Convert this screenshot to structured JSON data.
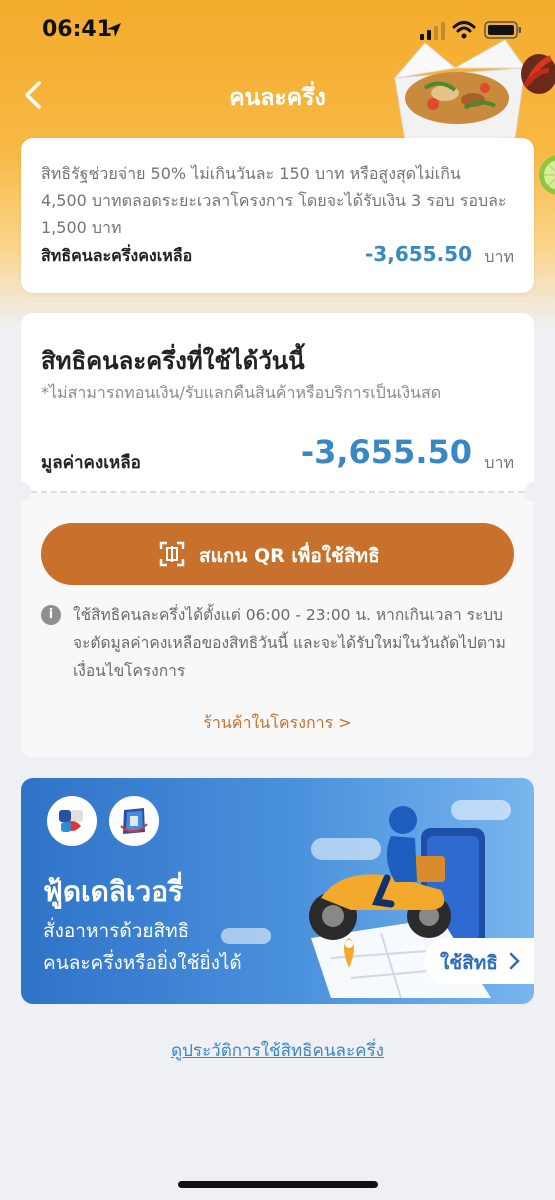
{
  "status_bar": {
    "time": "06:41"
  },
  "header": {
    "title": "คนละครึ่ง"
  },
  "summary_card": {
    "description": "สิทธิรัฐช่วยจ่าย 50% ไม่เกินวันละ 150 บาท หรือสูงสุดไม่เกิน 4,500 บาทตลอดระยะเวลาโครงการ โดยจะได้รับเงิน 3 รอบ รอบละ 1,500 บาท",
    "remaining_label": "สิทธิคนละครึ่งคงเหลือ",
    "remaining_amount": "-3,655.50",
    "unit": "บาท"
  },
  "today_card": {
    "title": "สิทธิคนละครึ่งที่ใช้ได้วันนี้",
    "note": "*ไม่สามารถทอนเงิน/รับแลกคืนสินค้าหรือบริการเป็นเงินสด",
    "balance_label": "มูลค่าคงเหลือ",
    "balance_amount": "-3,655.50",
    "unit": "บาท",
    "scan_button": "สแกน QR เพื่อใช้สิทธิ",
    "info_text": "ใช้สิทธิคนละครึ่งได้ตั้งแต่ 06:00 - 23:00 น. หากเกินเวลา ระบบจะตัดมูลค่าคงเหลือของสิทธิวันนี้ และจะได้รับใหม่ในวันถัดไปตามเงื่อนไขโครงการ",
    "shop_link": "ร้านค้าในโครงการ >"
  },
  "banner": {
    "title": "ฟู้ดเดลิเวอรี่",
    "subtitle_line1": "สั่งอาหารด้วยสิทธิ",
    "subtitle_line2": "คนละครึ่งหรือยิ่งใช้ยิ่งได้",
    "button": "ใช้สิทธิ"
  },
  "history_link": "ดูประวัติการใช้สิทธิคนละครึ่ง",
  "colors": {
    "accent_orange": "#c8712c",
    "amount_blue": "#3a87c5",
    "header_yellow": "#f4ac2c",
    "banner_blue": "#2f73c7"
  }
}
